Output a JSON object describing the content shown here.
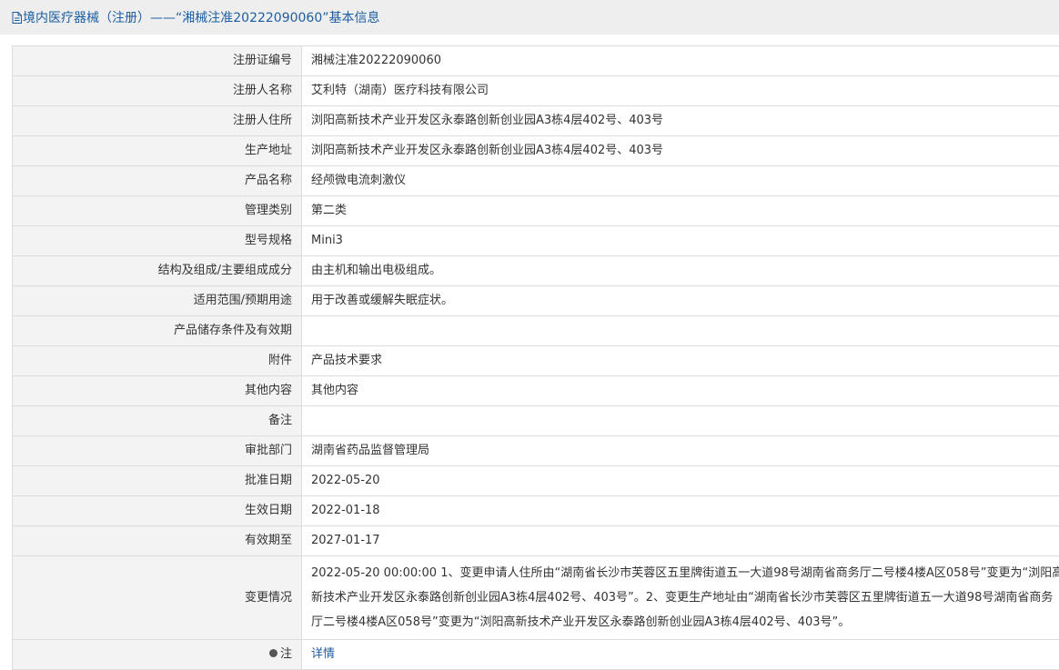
{
  "header": {
    "icon": "document-icon",
    "title": "境内医疗器械（注册）——“湘械注准20222090060”基本信息"
  },
  "rows": [
    {
      "label": "注册证编号",
      "value": "湘械注准20222090060"
    },
    {
      "label": "注册人名称",
      "value": "艾利特（湖南）医疗科技有限公司"
    },
    {
      "label": "注册人住所",
      "value": "浏阳高新技术产业开发区永泰路创新创业园A3栋4层402号、403号"
    },
    {
      "label": "生产地址",
      "value": "浏阳高新技术产业开发区永泰路创新创业园A3栋4层402号、403号"
    },
    {
      "label": "产品名称",
      "value": "经颅微电流刺激仪"
    },
    {
      "label": "管理类别",
      "value": "第二类"
    },
    {
      "label": "型号规格",
      "value": "Mini3"
    },
    {
      "label": "结构及组成/主要组成成分",
      "value": "由主机和输出电极组成。"
    },
    {
      "label": "适用范围/预期用途",
      "value": "用于改善或缓解失眠症状。"
    },
    {
      "label": "产品储存条件及有效期",
      "value": ""
    },
    {
      "label": "附件",
      "value": "产品技术要求"
    },
    {
      "label": "其他内容",
      "value": "其他内容"
    },
    {
      "label": "备注",
      "value": ""
    },
    {
      "label": "审批部门",
      "value": "湖南省药品监督管理局"
    },
    {
      "label": "批准日期",
      "value": "2022-05-20"
    },
    {
      "label": "生效日期",
      "value": "2022-01-18"
    },
    {
      "label": "有效期至",
      "value": "2027-01-17"
    },
    {
      "label": "变更情况",
      "value": "2022-05-20 00:00:00 1、变更申请人住所由“湖南省长沙市芙蓉区五里牌街道五一大道98号湖南省商务厅二号楼4楼A区058号”变更为“浏阳高新技术产业开发区永泰路创新创业园A3栋4层402号、403号”。2、变更生产地址由“湖南省长沙市芙蓉区五里牌街道五一大道98号湖南省商务厅二号楼4楼A区058号”变更为“浏阳高新技术产业开发区永泰路创新创业园A3栋4层402号、403号”。"
    }
  ],
  "last_row": {
    "label": "注",
    "icon": "note-icon",
    "link": "详情"
  },
  "colors": {
    "header_bg": "#eeeeee",
    "title_color": "#1c5ea0",
    "label_bg": "#f3f3f3",
    "border": "#dcdcdc"
  }
}
